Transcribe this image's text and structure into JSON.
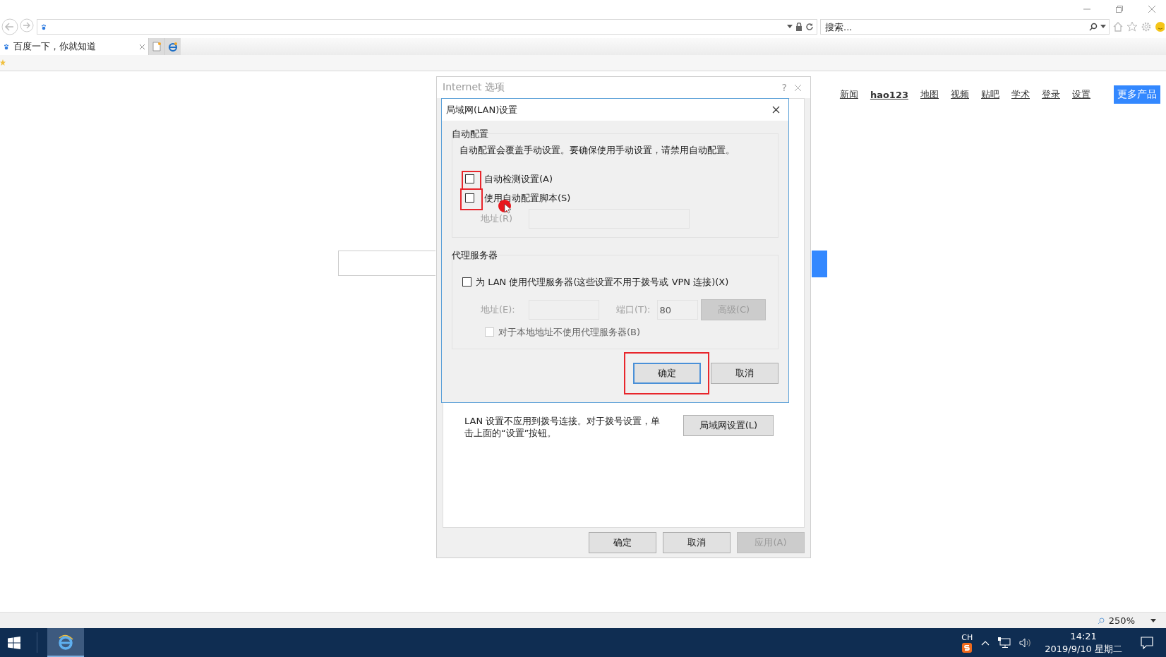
{
  "browser": {
    "search_placeholder": "搜索...",
    "tabs": [
      {
        "label": "百度一下，你就知道",
        "selected": true
      }
    ],
    "zoom": "250%"
  },
  "page": {
    "nav_links": [
      {
        "label": "新闻",
        "bold": false
      },
      {
        "label": "hao123",
        "bold": true
      },
      {
        "label": "地图",
        "bold": false
      },
      {
        "label": "视频",
        "bold": false
      },
      {
        "label": "贴吧",
        "bold": false
      },
      {
        "label": "学术",
        "bold": false
      },
      {
        "label": "登录",
        "bold": false
      },
      {
        "label": "设置",
        "bold": false
      }
    ],
    "more_button": "更多产品"
  },
  "internet_options": {
    "title": "Internet 选项",
    "help": "?",
    "lan_description": "LAN 设置不应用到拨号连接。对于拨号设置，单击上面的“设置”按钮。",
    "lan_button": "局域网设置(L)",
    "buttons": [
      {
        "label": "确定",
        "disabled": false
      },
      {
        "label": "取消",
        "disabled": false
      },
      {
        "label": "应用(A)",
        "disabled": true
      }
    ]
  },
  "lan_dialog": {
    "title": "局域网(LAN)设置",
    "auto_config": {
      "heading": "自动配置",
      "description": "自动配置会覆盖手动设置。要确保使用手动设置，请禁用自动配置。",
      "options": [
        {
          "label": "自动检测设置(A)",
          "checked": false,
          "highlighted": true
        },
        {
          "label": "使用自动配置脚本(S)",
          "checked": false,
          "highlighted": true
        }
      ],
      "address_label": "地址(R)"
    },
    "proxy": {
      "heading": "代理服务器",
      "option": {
        "label": "为 LAN 使用代理服务器(这些设置不用于拨号或 VPN 连接)(X)",
        "checked": false,
        "highlighted": false
      },
      "address_label": "地址(E):",
      "port_label": "端口(T):",
      "port_value": "80",
      "advanced_button": "高级(C)",
      "bypass": {
        "label": "对于本地地址不使用代理服务器(B)",
        "checked": false,
        "disabled": true
      }
    },
    "buttons": [
      {
        "label": "确定",
        "default": true,
        "highlighted": true
      },
      {
        "label": "取消",
        "default": false,
        "highlighted": false
      }
    ]
  },
  "taskbar": {
    "input_language": "CH",
    "time": "14:21",
    "date": "2019/9/10 星期二"
  }
}
